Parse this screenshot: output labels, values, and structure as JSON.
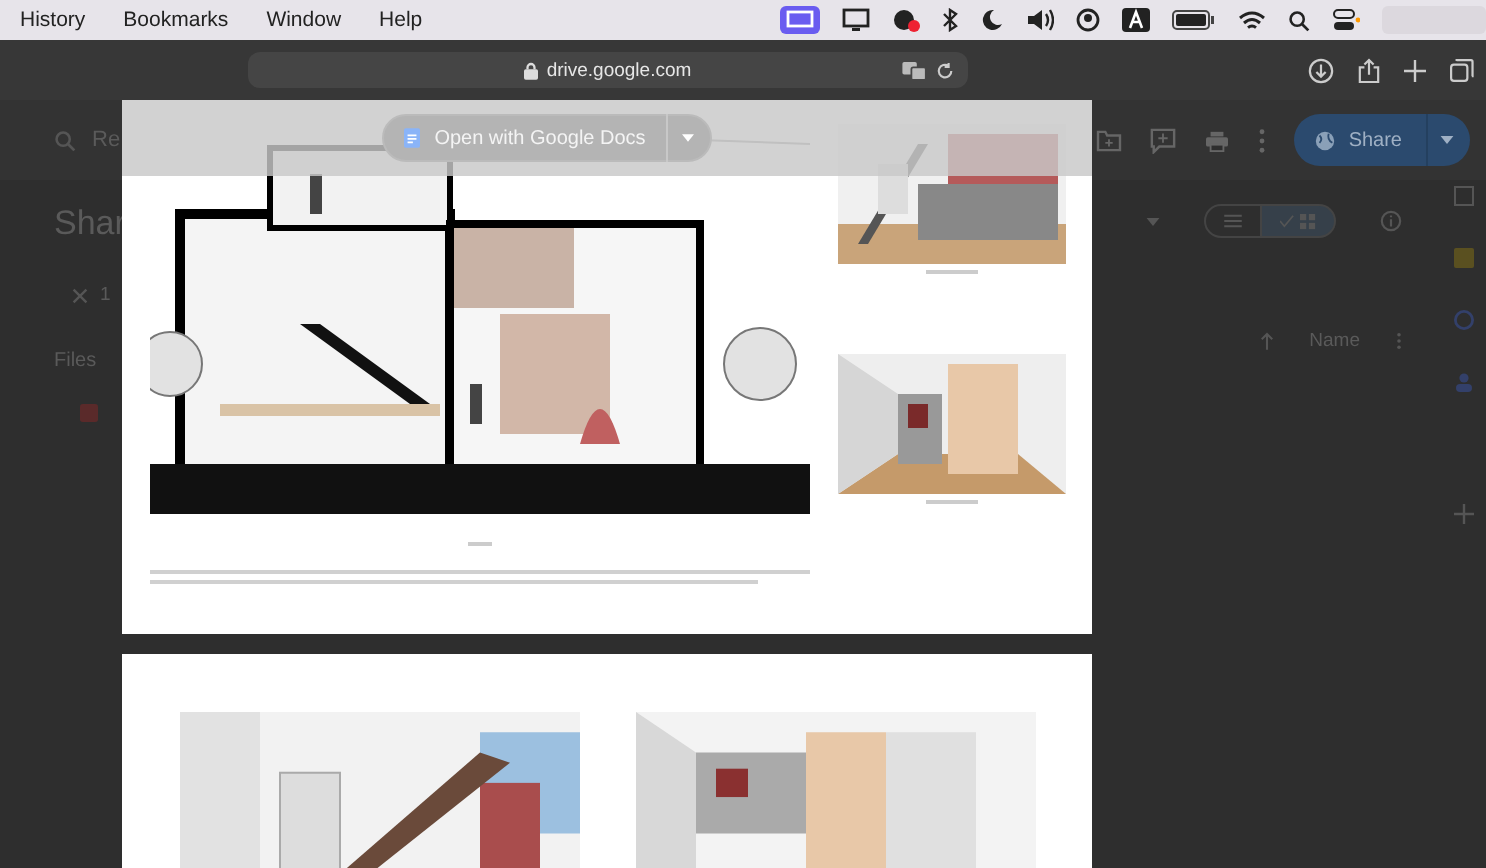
{
  "menu_bar": {
    "menus": [
      "History",
      "Bookmarks",
      "Window",
      "Help"
    ]
  },
  "browser": {
    "url": "drive.google.com"
  },
  "drive": {
    "search_text": "Re",
    "heading": "Shar",
    "selection_text": "1",
    "section": "Files",
    "sort_column": "Name",
    "share_button": "Share",
    "view_modes": [
      {
        "kind": "list",
        "selected": false
      },
      {
        "kind": "grid",
        "selected": true
      }
    ]
  },
  "preview": {
    "open_with": "Open with Google Docs"
  }
}
